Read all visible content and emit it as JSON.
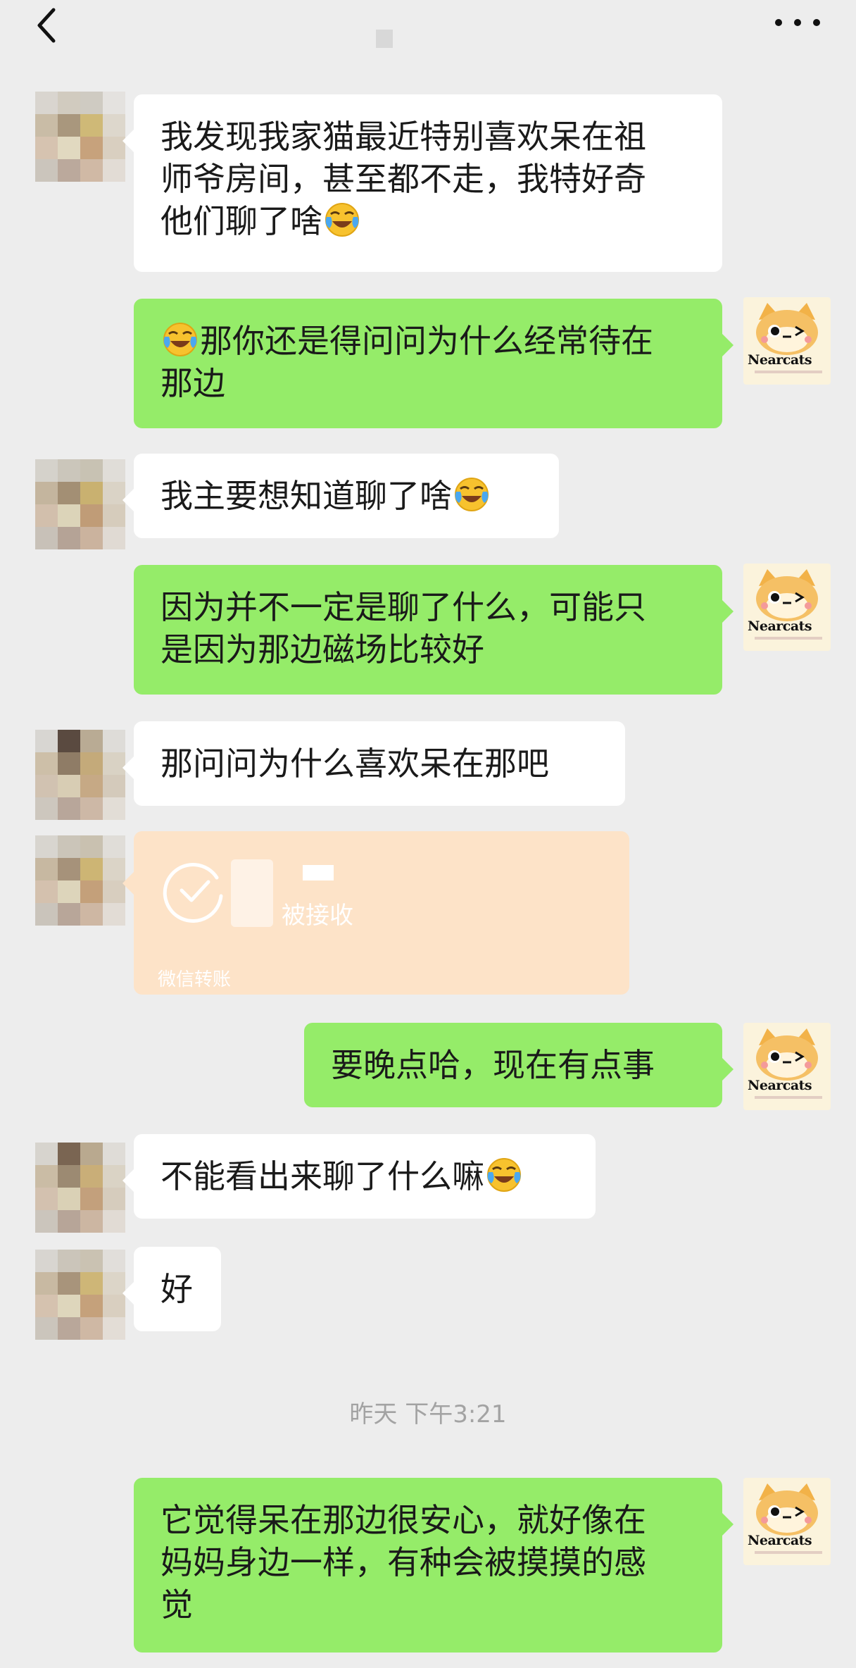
{
  "header": {
    "back_icon": "chevron-left-icon",
    "more_icon": "more-dots-icon"
  },
  "colors": {
    "background": "#ededed",
    "bubble_in": "#ffffff",
    "bubble_out": "#95ec69",
    "transfer_card": "#fde3c8",
    "timestamp": "#a3a3a3"
  },
  "self_avatar": {
    "text": "Nearcats"
  },
  "messages": [
    {
      "side": "left",
      "lines": [
        "我发现我家猫最近特别喜欢呆在祖",
        "师爷房间，甚至都不走，我特好奇",
        "他们聊了啥"
      ],
      "emoji": "laughing-crying-emoji"
    },
    {
      "side": "right",
      "lines": [
        "那你还是得问问为什么经常待在",
        "那边"
      ],
      "emoji": "laughing-crying-emoji"
    },
    {
      "side": "left",
      "lines": [
        "我主要想知道聊了啥"
      ],
      "emoji": "laughing-crying-emoji"
    },
    {
      "side": "right",
      "lines": [
        "因为并不一定是聊了什么，可能只",
        "是因为那边磁场比较好"
      ]
    },
    {
      "side": "left",
      "lines": [
        "那问问为什么喜欢呆在那吧"
      ]
    },
    {
      "side": "right",
      "lines": [
        "要晚点哈，现在有点事"
      ]
    },
    {
      "side": "left",
      "lines": [
        "不能看出来聊了什么嘛"
      ],
      "emoji": "laughing-crying-emoji"
    },
    {
      "side": "left",
      "lines": [
        "好"
      ]
    },
    {
      "side": "right",
      "lines": [
        "它觉得呆在那边很安心，就好像在",
        "妈妈身边一样，有种会被摸摸的感",
        "觉"
      ]
    }
  ],
  "transfer": {
    "status": "被接收",
    "footer": "微信转账",
    "icon": "check-circle-icon"
  },
  "timestamp": "昨天 下午3:21"
}
